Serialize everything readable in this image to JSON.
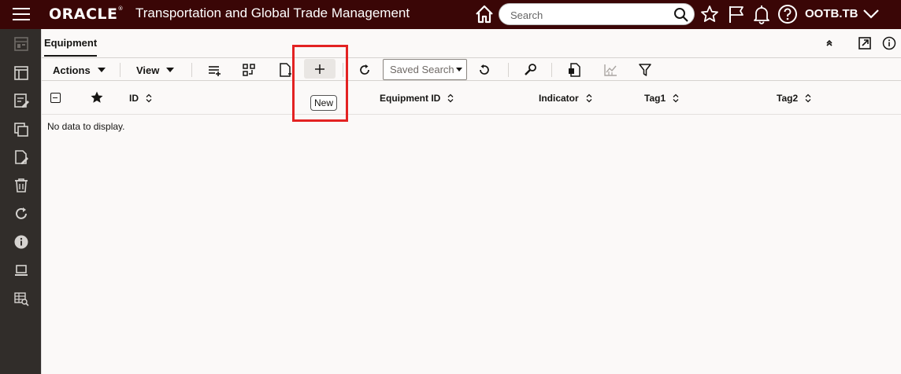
{
  "header": {
    "logo": "ORACLE",
    "title": "Transportation and Global Trade Management",
    "search_placeholder": "Search",
    "user": "OOTB.TB"
  },
  "tabbar": {
    "tab_label": "Equipment"
  },
  "toolbar": {
    "actions_label": "Actions",
    "view_label": "View",
    "saved_search_label": "Saved Search"
  },
  "tooltip": "New",
  "table": {
    "columns": [
      "ID",
      "Equipment ID",
      "Indicator",
      "Tag1",
      "Tag2"
    ],
    "empty_message": "No data to display."
  },
  "colors": {
    "header_bg": "#3a0606",
    "rail_bg": "#312d2a",
    "page_bg": "#fbf9f8",
    "highlight": "#e32222"
  }
}
